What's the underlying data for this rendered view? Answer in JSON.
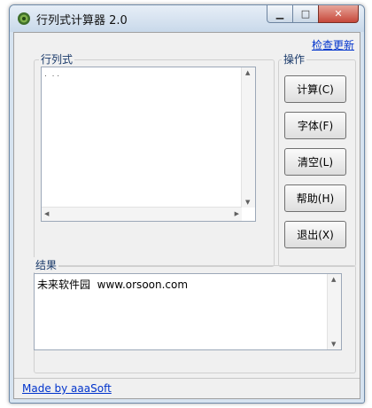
{
  "window": {
    "title": "行列式计算器 2.0",
    "min_icon": "▁",
    "max_icon": "□",
    "close_icon": "✕"
  },
  "links": {
    "update": "检查更新",
    "credit": "Made by aaaSoft"
  },
  "determinant": {
    "label": "行列式",
    "content": ".  . ."
  },
  "operations": {
    "label": "操作",
    "buttons": [
      "计算(C)",
      "字体(F)",
      "清空(L)",
      "帮助(H)",
      "退出(X)"
    ]
  },
  "result": {
    "label": "结果",
    "content": "未来软件园  www.orsoon.com"
  },
  "colors": {
    "link": "#0033cc",
    "close_button": "#c6483a"
  }
}
